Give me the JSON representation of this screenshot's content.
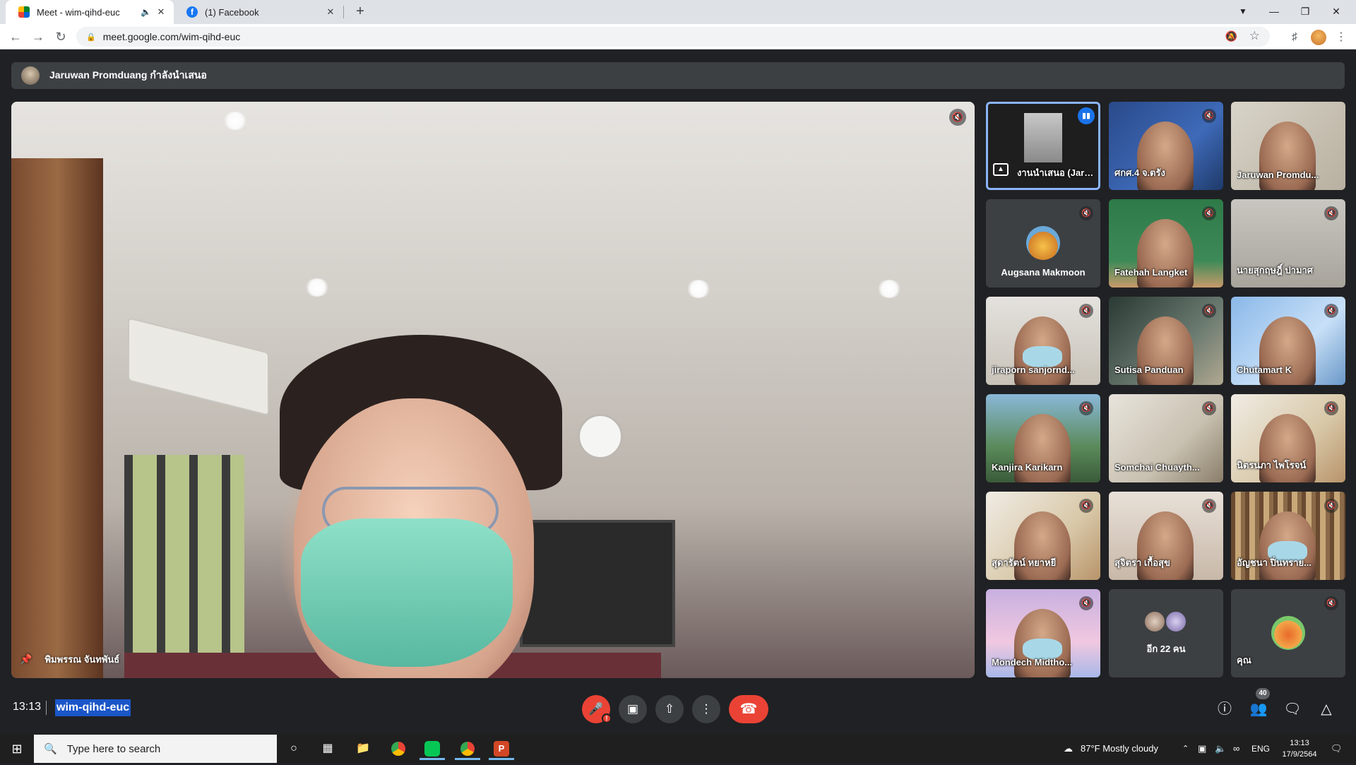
{
  "browser": {
    "tabs": [
      {
        "title": "Meet - wim-qihd-euc",
        "active": true
      },
      {
        "title": "(1) Facebook",
        "active": false
      }
    ],
    "url": "meet.google.com/wim-qihd-euc"
  },
  "meet": {
    "presenting_banner": "Jaruwan Promduang กำลังนำเสนอ",
    "main_video_name": "พิมพรรณ จันทพันธ์",
    "participants": [
      {
        "name": "งานนำเสนอ (Jaruwan Pr...",
        "kind": "presentation"
      },
      {
        "name": "ศกศ.4 จ.ตรัง",
        "kind": "video"
      },
      {
        "name": "Jaruwan Promdu...",
        "kind": "video"
      },
      {
        "name": "Augsana Makmoon",
        "kind": "avatar"
      },
      {
        "name": "Fatehah Langket",
        "kind": "video"
      },
      {
        "name": "นายสุกฤษฎิ์ ปามาศ",
        "kind": "video"
      },
      {
        "name": "jiraporn sanjornd...",
        "kind": "video"
      },
      {
        "name": "Sutisa Panduan",
        "kind": "video"
      },
      {
        "name": "Chutamart K",
        "kind": "video"
      },
      {
        "name": "Kanjira Karikarn",
        "kind": "video"
      },
      {
        "name": "Somchai Chuayth...",
        "kind": "video"
      },
      {
        "name": "นิตรนภา ไพโรจน์",
        "kind": "video"
      },
      {
        "name": "สุดารัตน์ หยาหยี",
        "kind": "video"
      },
      {
        "name": "สุจิตรา เกื้อสุข",
        "kind": "video"
      },
      {
        "name": "อัญชนา ปิ่นทราย...",
        "kind": "video"
      },
      {
        "name": "Mondech Midtho...",
        "kind": "video"
      },
      {
        "name": "อีก 22 คน",
        "kind": "more"
      },
      {
        "name": "คุณ",
        "kind": "self"
      }
    ],
    "time": "13:13",
    "meeting_code": "wim-qihd-euc",
    "people_count": "40"
  },
  "taskbar": {
    "search_placeholder": "Type here to search",
    "weather": "87°F  Mostly cloudy",
    "language": "ENG",
    "clock_time": "13:13",
    "clock_date": "17/9/2564"
  }
}
